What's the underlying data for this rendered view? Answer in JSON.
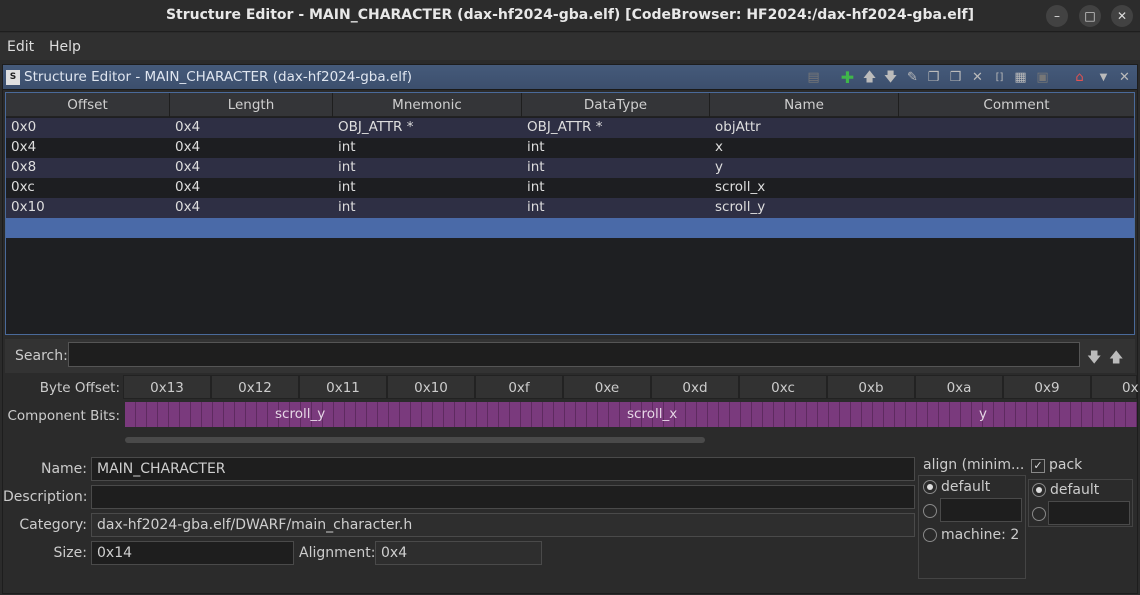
{
  "window": {
    "title": "Structure Editor - MAIN_CHARACTER (dax-hf2024-gba.elf) [CodeBrowser: HF2024:/dax-hf2024-gba.elf]"
  },
  "menu": {
    "edit": "Edit",
    "help": "Help"
  },
  "panel": {
    "title": "Structure Editor - MAIN_CHARACTER (dax-hf2024-gba.elf)"
  },
  "table": {
    "headers": [
      "Offset",
      "Length",
      "Mnemonic",
      "DataType",
      "Name",
      "Comment"
    ],
    "rows": [
      {
        "offset": "0x0",
        "length": "0x4",
        "mnemonic": "OBJ_ATTR *",
        "datatype": "OBJ_ATTR *",
        "name": "objAttr",
        "comment": ""
      },
      {
        "offset": "0x4",
        "length": "0x4",
        "mnemonic": "int",
        "datatype": "int",
        "name": "x",
        "comment": ""
      },
      {
        "offset": "0x8",
        "length": "0x4",
        "mnemonic": "int",
        "datatype": "int",
        "name": "y",
        "comment": ""
      },
      {
        "offset": "0xc",
        "length": "0x4",
        "mnemonic": "int",
        "datatype": "int",
        "name": "scroll_x",
        "comment": ""
      },
      {
        "offset": "0x10",
        "length": "0x4",
        "mnemonic": "int",
        "datatype": "int",
        "name": "scroll_y",
        "comment": ""
      }
    ]
  },
  "search": {
    "label": "Search:",
    "value": ""
  },
  "bytes": {
    "offset_label": "Byte Offset:",
    "bits_label": "Component Bits:",
    "offsets": [
      "0x13",
      "0x12",
      "0x11",
      "0x10",
      "0xf",
      "0xe",
      "0xd",
      "0xc",
      "0xb",
      "0xa",
      "0x9",
      "0x"
    ],
    "components": [
      "scroll_y",
      "scroll_x",
      "y"
    ]
  },
  "form": {
    "name_label": "Name:",
    "name": "MAIN_CHARACTER",
    "desc_label": "Description:",
    "description": "",
    "category_label": "Category:",
    "category": "dax-hf2024-gba.elf/DWARF/main_character.h",
    "size_label": "Size:",
    "size": "0x14",
    "alignment_label": "Alignment:",
    "alignment": "0x4"
  },
  "align": {
    "title": "align (minim...",
    "default": "default",
    "machine": "machine: 2"
  },
  "pack": {
    "title": "pack",
    "default": "default"
  },
  "colors": {
    "selection": "#4a6aa8",
    "bits": "#7a3a7d",
    "title_bar": "#455a7a"
  }
}
